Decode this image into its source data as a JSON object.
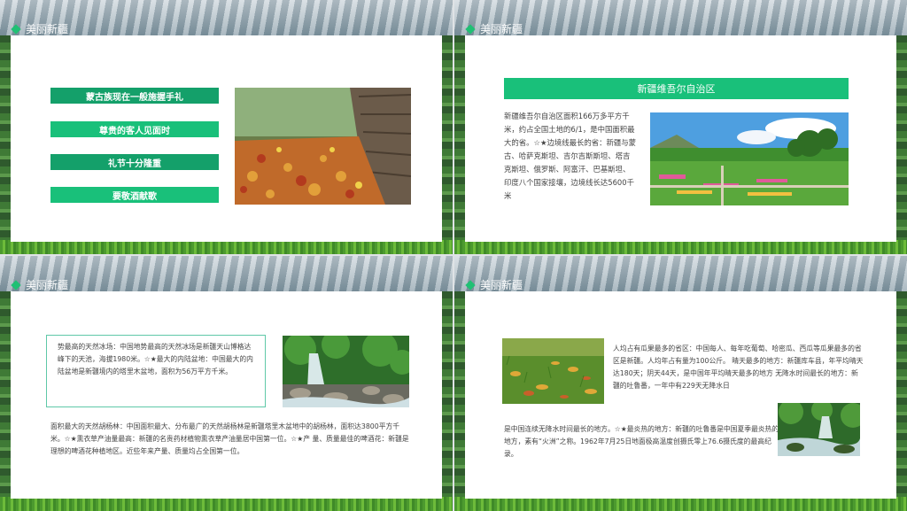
{
  "brand": "美丽新疆",
  "slide1": {
    "items": [
      "蒙古族现在一般施握手礼",
      "尊贵的客人见面时",
      "礼节十分隆重",
      "要敬酒献歌"
    ]
  },
  "slide2": {
    "title": "新疆维吾尔自治区",
    "body": "新疆维吾尔自治区面积166万多平方千米，约占全国土地的6/1，是中国面积最大的省。☆★边境线最长的省：新疆与蒙古、哈萨克斯坦、吉尔吉斯斯坦、塔吉克斯坦、俄罗斯、阿富汗、巴基斯坦、印度八个国家接壤，边境线长达5600千米"
  },
  "slide3": {
    "box": "势最高的天然冰场：中国地势最高的天然冰场是新疆天山博格达峰下的天池，海拔1980米。☆★最大的内陆盆地：中国最大的内陆盆地是新疆境内的塔里木盆地，面积为56万平方千米。",
    "bottom": "面积最大的天然胡杨林：中国面积最大、分布最广的天然胡杨林是新疆塔里木盆地中的胡杨林，面积达3800平方千米。☆★熏衣草产油量最高：新疆的名贵药材植物熏衣草产油量居中国第一位。☆★产 量、质量最佳的啤酒花：新疆是理想的啤酒花种植地区。近些年来产量、质量均占全国第一位。"
  },
  "slide4": {
    "top": "人均占有瓜果最多的省区：中国每人、每年吃葡萄、哈密瓜、西瓜等瓜果最多的省区是新疆。人均年占有量为100公斤。 晴天最多的地方：新疆库车县，年平均晴天达180天；阴天44天，是中国年平均晴天最多的地方 无降水时间最长的地方：新疆的吐鲁番，一年中有229天无降水日",
    "bottom": "是中国连续无降水时间最长的地方。☆★最炎热的地方：新疆的吐鲁番是中国夏季最炎热的地方，素有“火洲”之称。1962年7月25日地面极高温度创摄氏零上76.6摄氏度的最高纪录。"
  }
}
